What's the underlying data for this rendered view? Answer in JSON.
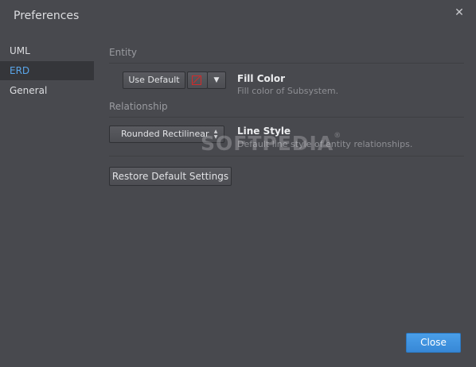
{
  "window": {
    "title": "Preferences",
    "close_glyph": "✕"
  },
  "sidebar": {
    "items": [
      {
        "label": "UML",
        "active": false
      },
      {
        "label": "ERD",
        "active": true
      },
      {
        "label": "General",
        "active": false
      }
    ]
  },
  "entity": {
    "section_label": "Entity",
    "use_default_label": "Use Default",
    "swatch_color": "#d22a2a",
    "dropdown_glyph": "▼",
    "fill_color_title": "Fill Color",
    "fill_color_desc": "Fill color of Subsystem."
  },
  "relationship": {
    "section_label": "Relationship",
    "line_style_value": "Rounded Rectilinear",
    "line_style_title": "Line Style",
    "line_style_desc": "Default line style of entity relationships."
  },
  "restore_label": "Restore Default Settings",
  "close_label": "Close",
  "watermark": {
    "text": "SOFTPEDIA",
    "mark": "®"
  },
  "colors": {
    "background": "#48494e",
    "sidebar_active_bg": "#35363a",
    "accent": "#5aa6ea",
    "primary_button": "#3d8fdc"
  }
}
